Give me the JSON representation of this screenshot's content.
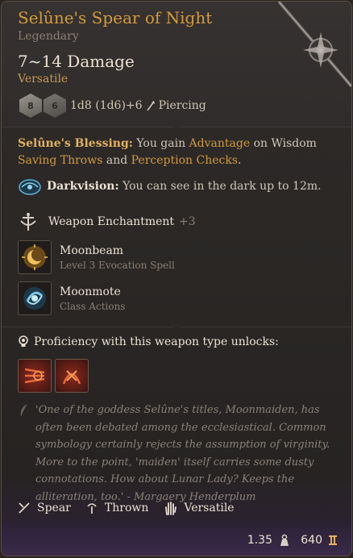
{
  "item": {
    "name": "Selûne's Spear of Night",
    "rarity": "Legendary",
    "damage": "7~14 Damage",
    "property": "Versatile",
    "dice": [
      {
        "label": "8"
      },
      {
        "label": "6"
      }
    ],
    "dice_formula": "1d8 (1d6)+6",
    "damage_type": "Piercing"
  },
  "blessing": {
    "name": "Selûne's Blessing:",
    "t1": " You gain ",
    "advantage": "Advantage",
    "t2": " on Wisdom",
    "saving_throws": "Saving Throws",
    "t3": " and ",
    "perception": "Perception Checks",
    "t4": "."
  },
  "darkvision": {
    "name": "Darkvision:",
    "text": " You can see in the dark up to 12m."
  },
  "enchantment": {
    "label": "Weapon Enchantment",
    "value": "+3"
  },
  "spells": [
    {
      "name": "Moonbeam",
      "sub": "Level 3 Evocation Spell"
    },
    {
      "name": "Moonmote",
      "sub": "Class Actions"
    }
  ],
  "proficiency": {
    "label": "Proficiency with this weapon type unlocks:"
  },
  "quote": "'One of the goddess Selûne's titles, Moonmaiden, has often been debated among the ecclesiastical. Common symbology certainly rejects the assumption of virginity. More to the point, 'maiden' itself carries some dusty connotations. How about Lunar Lady? Keeps the alliteration, too.' - Margaery Henderplum",
  "properties": [
    {
      "label": "Spear",
      "icon": "spear-icon"
    },
    {
      "label": "Thrown",
      "icon": "thrown-icon"
    },
    {
      "label": "Versatile",
      "icon": "versatile-hand-icon"
    }
  ],
  "footer": {
    "weight": "1.35",
    "value": "640"
  },
  "colors": {
    "title": "#d39a3d",
    "accent_gold": "#c59a4e",
    "muted": "#8a7f73",
    "text": "#ece2d3",
    "footer_purple": "#3a2a4a"
  }
}
